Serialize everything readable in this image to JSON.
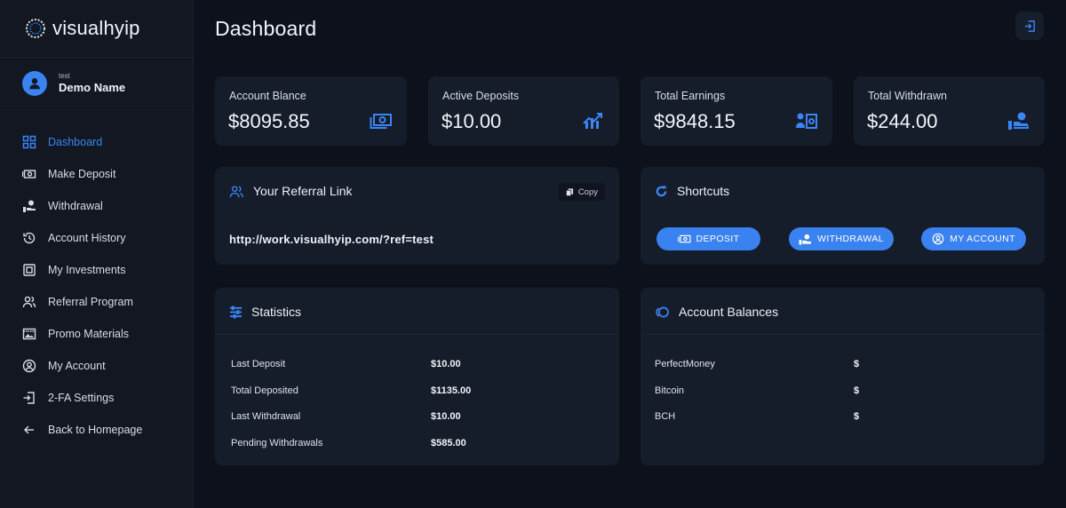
{
  "brand": {
    "name": "visualhyip"
  },
  "user": {
    "small_label": "test",
    "name": "Demo Name"
  },
  "nav": [
    {
      "label": "Dashboard",
      "icon": "grid-icon",
      "active": true
    },
    {
      "label": "Make Deposit",
      "icon": "cash-icon"
    },
    {
      "label": "Withdrawal",
      "icon": "hand-coin-icon"
    },
    {
      "label": "Account History",
      "icon": "history-icon"
    },
    {
      "label": "My Investments",
      "icon": "investment-icon"
    },
    {
      "label": "Referral Program",
      "icon": "users-icon"
    },
    {
      "label": "Promo Materials",
      "icon": "image-icon"
    },
    {
      "label": "My Account",
      "icon": "user-circle-icon"
    },
    {
      "label": "2-FA Settings",
      "icon": "login-icon"
    },
    {
      "label": "Back to Homepage",
      "icon": "arrow-left-icon"
    }
  ],
  "header": {
    "title": "Dashboard"
  },
  "stats": [
    {
      "label": "Account Blance",
      "value": "$8095.85",
      "icon": "cash-icon"
    },
    {
      "label": "Active Deposits",
      "value": "$10.00",
      "icon": "chart-growth-icon"
    },
    {
      "label": "Total Earnings",
      "value": "$9848.15",
      "icon": "earnings-icon"
    },
    {
      "label": "Total Withdrawn",
      "value": "$244.00",
      "icon": "hand-coin-icon"
    }
  ],
  "referral": {
    "title": "Your Referral Link",
    "copy_label": "Copy",
    "link": "http://work.visualhyip.com/?ref=test"
  },
  "shortcuts": {
    "title": "Shortcuts",
    "buttons": [
      {
        "label": "DEPOSIT",
        "icon": "cash-icon"
      },
      {
        "label": "WITHDRAWAL",
        "icon": "hand-coin-icon"
      },
      {
        "label": "MY ACCOUNT",
        "icon": "user-circle-icon"
      }
    ]
  },
  "statistics": {
    "title": "Statistics",
    "rows": [
      {
        "label": "Last Deposit",
        "value": "$10.00"
      },
      {
        "label": "Total Deposited",
        "value": "$1135.00"
      },
      {
        "label": "Last Withdrawal",
        "value": "$10.00"
      },
      {
        "label": "Pending Withdrawals",
        "value": "$585.00"
      }
    ]
  },
  "balances": {
    "title": "Account Balances",
    "rows": [
      {
        "label": "PerfectMoney",
        "value": "$"
      },
      {
        "label": "Bitcoin",
        "value": "$"
      },
      {
        "label": "BCH",
        "value": "$"
      }
    ]
  },
  "colors": {
    "accent": "#3b86f5",
    "card": "#151c2a",
    "background": "#0d111b",
    "sidebar": "#121722"
  }
}
